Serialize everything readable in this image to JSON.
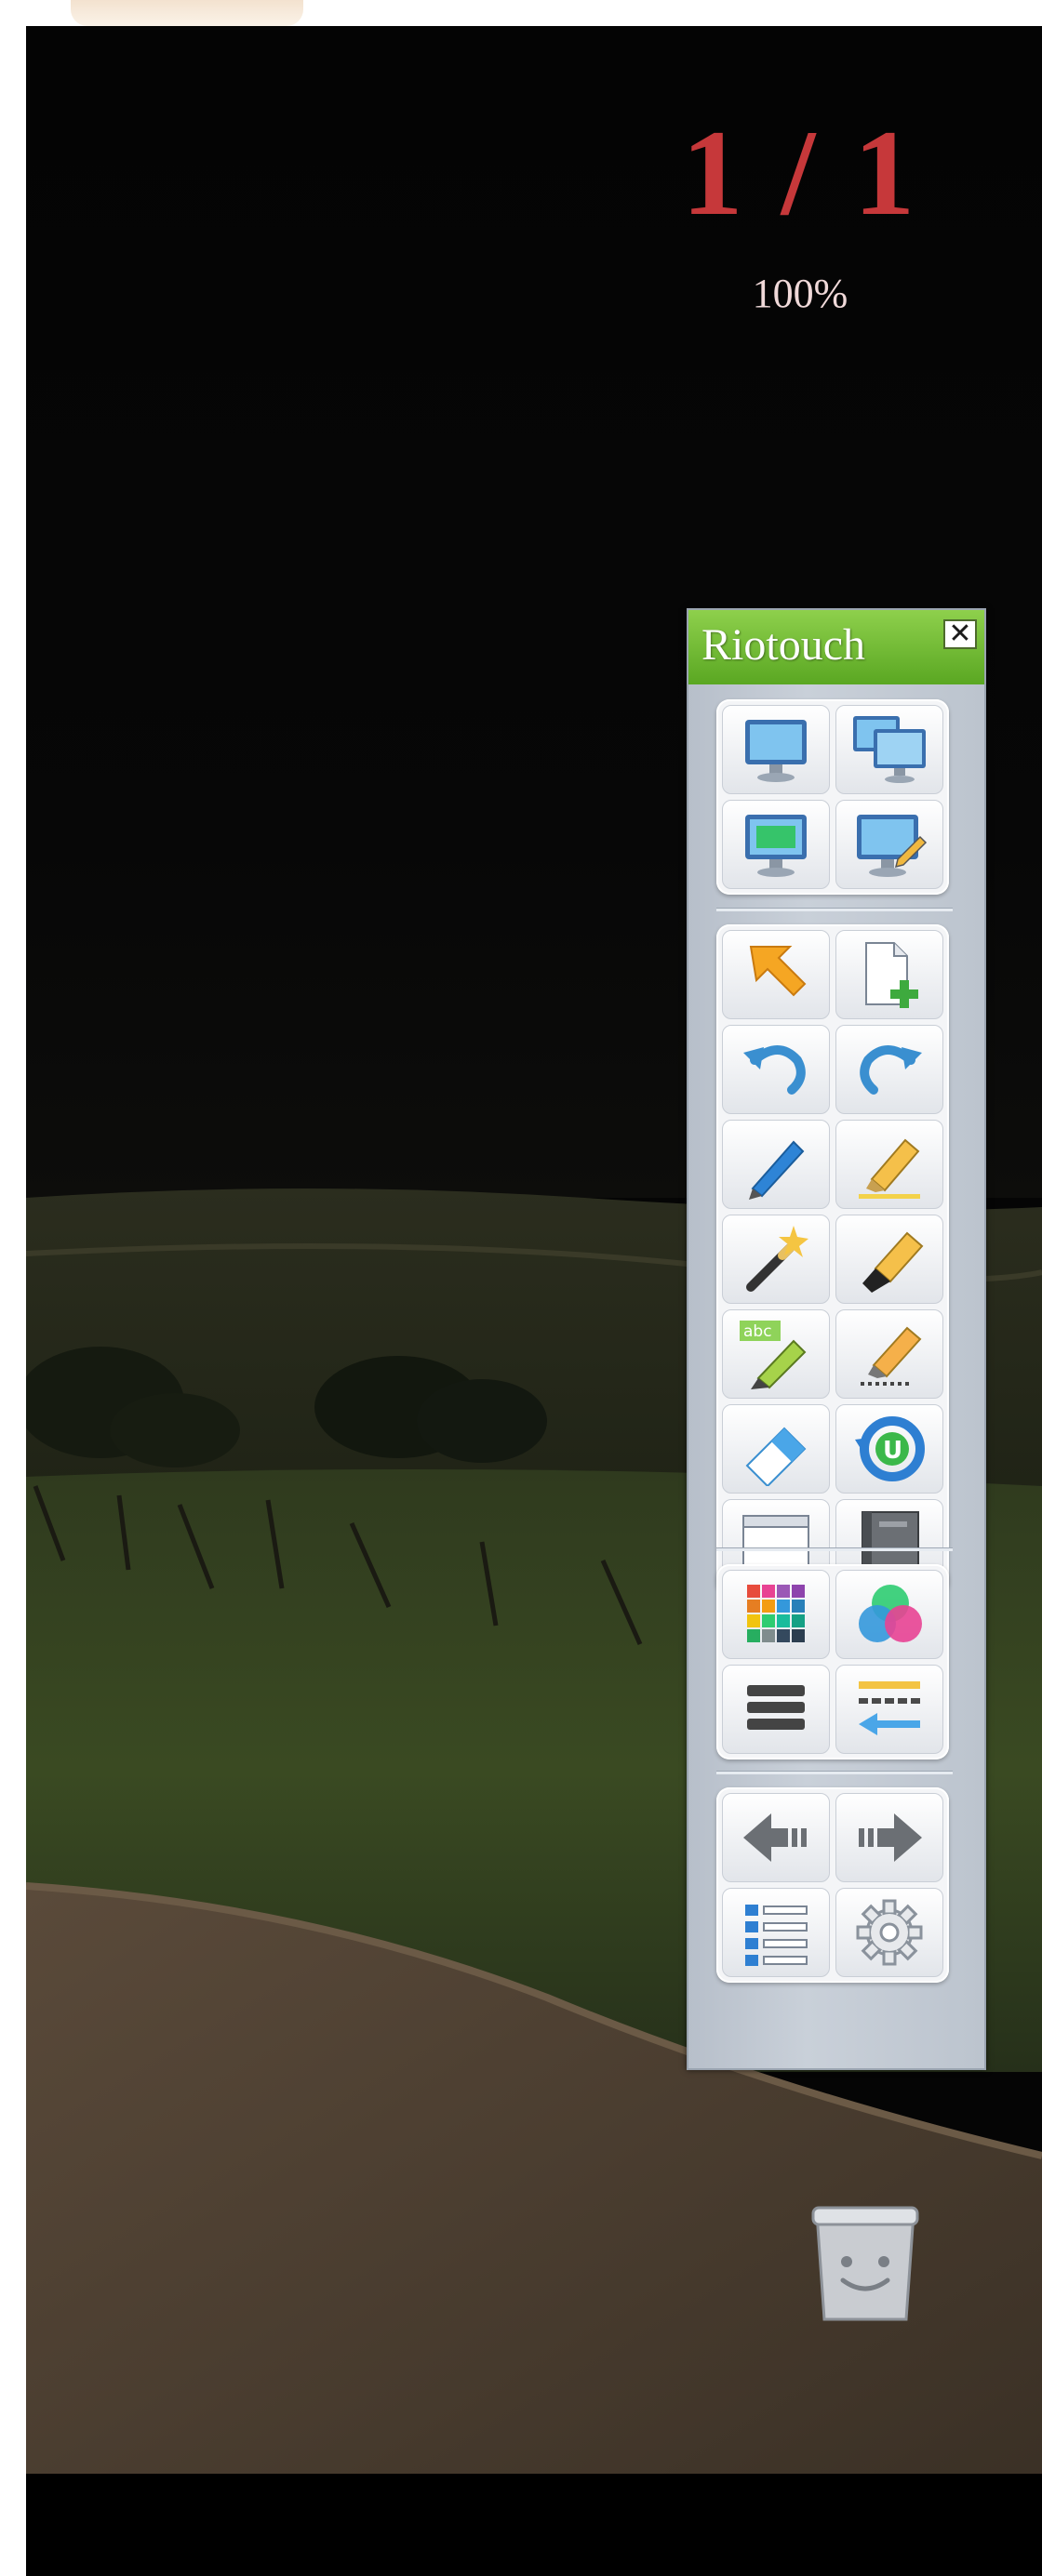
{
  "page_counter": "1 / 1",
  "zoom_level": "100%",
  "panel": {
    "title": "Riotouch",
    "close_symbol": "✕"
  },
  "colors": {
    "title_bar": "#6ab92d",
    "page_counter": "#c6383a",
    "panel_background": "#c4cbd4"
  },
  "groups": [
    {
      "id": "display",
      "buttons": [
        "monitor-icon",
        "dual-monitor-icon",
        "green-screen-monitor-icon",
        "monitor-pen-icon"
      ]
    },
    {
      "id": "tools",
      "buttons": [
        "arrow-pointer-icon",
        "new-page-icon",
        "undo-icon",
        "redo-icon",
        "pen-icon",
        "highlighter-icon",
        "magic-wand-icon",
        "marker-icon",
        "text-pen-icon",
        "smart-pen-icon",
        "eraser-icon",
        "refresh-u-icon",
        "window-icon",
        "book-icon"
      ]
    },
    {
      "id": "style",
      "buttons": [
        "color-palette-icon",
        "color-circles-icon",
        "line-width-icon",
        "line-style-icon"
      ]
    },
    {
      "id": "navigation",
      "buttons": [
        "previous-page-icon",
        "next-page-icon",
        "list-icon",
        "settings-gear-icon"
      ]
    }
  ]
}
